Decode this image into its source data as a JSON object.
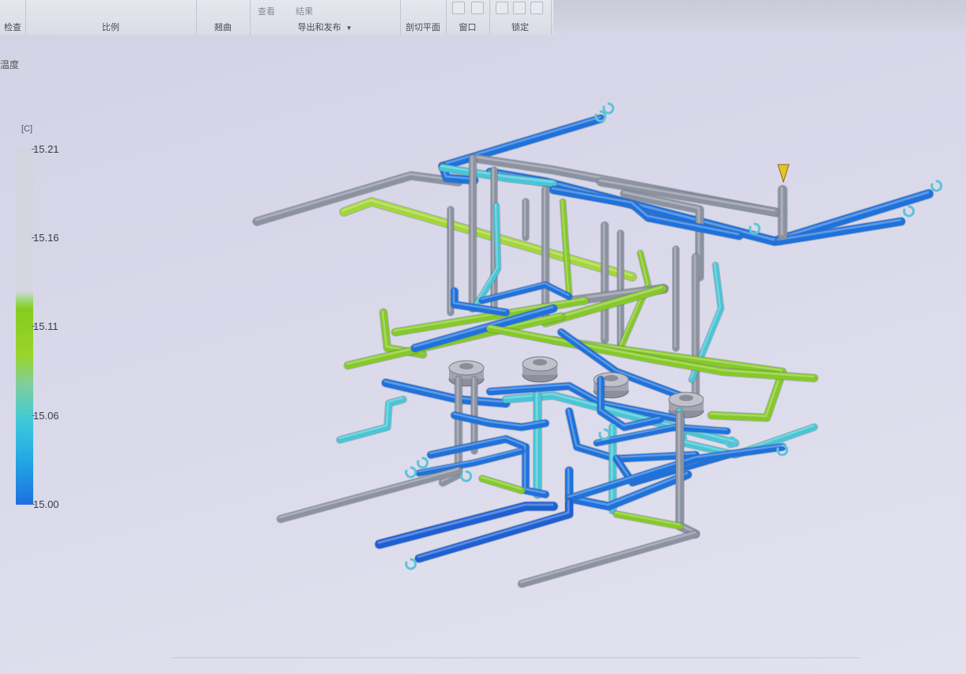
{
  "ribbon": {
    "groups": [
      {
        "label": "检查"
      },
      {
        "label": "比例"
      },
      {
        "label": "翘曲"
      },
      {
        "label": "导出和发布",
        "buttons": [
          "查看",
          "结果"
        ]
      },
      {
        "label": "剖切平面"
      },
      {
        "label": "窗口"
      },
      {
        "label": "锁定"
      }
    ]
  },
  "result_title": "温度",
  "legend": {
    "unit": "[C]",
    "ticks": [
      "15.21",
      "15.16",
      "15.11",
      "15.06",
      "15.00"
    ]
  },
  "colors": {
    "gray_pipe": "#8c92a0",
    "green_pipe": "#86c928",
    "lightgreen_pipe": "#a4d63a",
    "cyan_pipe": "#48c6d6",
    "blue_pipe": "#1f72dc",
    "deepblue_pipe": "#1e5fd4",
    "gate": "#e8c12c"
  }
}
